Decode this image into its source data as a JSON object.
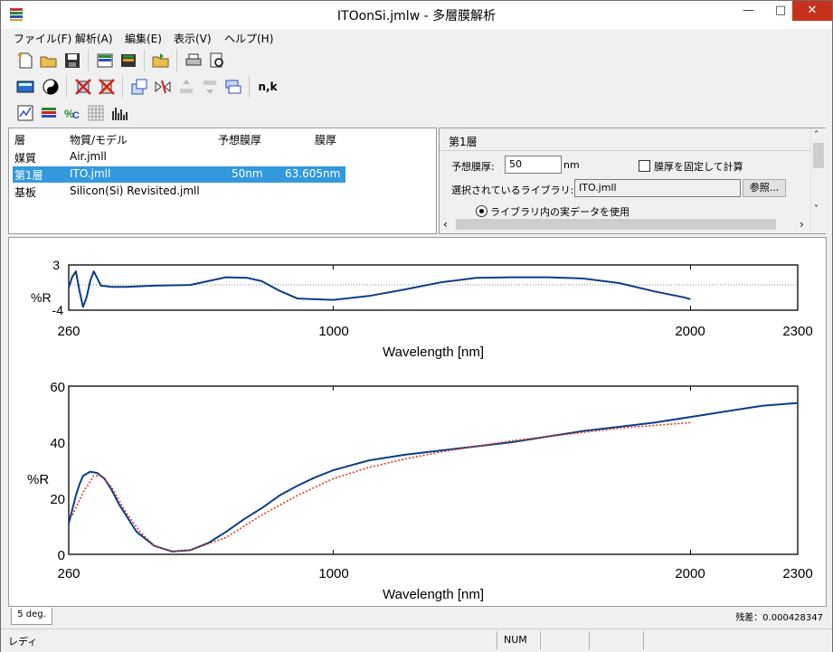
{
  "window": {
    "title": "ITOonSi.jmlw - 多層膜解析",
    "minimize": "—",
    "maximize": "□",
    "close": "✕"
  },
  "menu": [
    "ファイル(F)",
    "解析(A)",
    "編集(E)",
    "表示(V)",
    "ヘルプ(H)"
  ],
  "toolbar": {
    "nk_label": "n,k"
  },
  "layer_list": {
    "headers": {
      "layer": "層",
      "material": "物質/モデル",
      "expected": "予想膜厚",
      "thickness": "膜厚"
    },
    "rows": [
      {
        "layer": "媒質",
        "material": "Air.jmll",
        "expected": "",
        "thickness": ""
      },
      {
        "layer": "第1層",
        "material": "ITO.jmll",
        "expected": "50nm",
        "thickness": "63.605nm"
      },
      {
        "layer": "基板",
        "material": "Silicon(Si) Revisited.jmll",
        "expected": "",
        "thickness": ""
      }
    ]
  },
  "properties": {
    "title": "第1層",
    "expected_label": "予想膜厚:",
    "expected_value": "50",
    "unit": "nm",
    "fix_label": "膜厚を固定して計算",
    "library_label": "選択されているライブラリ:",
    "library_value": "ITO.jmll",
    "browse": "参照...",
    "radio_label": "ライブラリ内の実データを使用"
  },
  "chart_data": [
    {
      "type": "line",
      "ylabel": "%R",
      "xlabel": "Wavelength [nm]",
      "xlim": [
        260,
        2300
      ],
      "ylim": [
        -4,
        3
      ],
      "xticks": [
        "260",
        "1000",
        "2000",
        "2300"
      ],
      "yticks": [
        "3",
        "-4"
      ],
      "series": [
        {
          "color": "#0a3d8a",
          "x": [
            260,
            270,
            280,
            290,
            300,
            310,
            320,
            330,
            350,
            380,
            420,
            500,
            600,
            700,
            760,
            800,
            850,
            900,
            950,
            1000,
            1100,
            1200,
            1300,
            1400,
            1500,
            1600,
            1700,
            1800,
            1900,
            1980,
            2000
          ],
          "y": [
            -0.5,
            1.2,
            2.0,
            -1.0,
            -3.5,
            -2.0,
            0.5,
            2.0,
            -0.2,
            -0.4,
            -0.4,
            -0.2,
            -0.1,
            1.1,
            1.0,
            0.5,
            -1.0,
            -2.2,
            -2.3,
            -2.4,
            -1.8,
            -0.8,
            0.3,
            1.0,
            1.1,
            1.1,
            0.9,
            0.2,
            -1.1,
            -2.0,
            -2.3
          ]
        }
      ]
    },
    {
      "type": "line",
      "ylabel": "%R",
      "xlabel": "Wavelength [nm]",
      "xlim": [
        260,
        2300
      ],
      "ylim": [
        0,
        60
      ],
      "xticks": [
        "260",
        "1000",
        "2000",
        "2300"
      ],
      "yticks": [
        "60",
        "40",
        "20",
        "0"
      ],
      "series": [
        {
          "color": "#0a3d8a",
          "x": [
            260,
            270,
            280,
            290,
            300,
            320,
            340,
            360,
            380,
            400,
            450,
            500,
            550,
            600,
            650,
            700,
            750,
            800,
            850,
            900,
            950,
            1000,
            1100,
            1200,
            1300,
            1400,
            1500,
            1600,
            1700,
            1800,
            1900,
            2000,
            2100,
            2200,
            2300
          ],
          "y": [
            11,
            16,
            21,
            25,
            28,
            29.5,
            29,
            27,
            23,
            18,
            8,
            3,
            1,
            1.5,
            4,
            8,
            12.5,
            16.5,
            21,
            24.5,
            27.5,
            30,
            33.5,
            35.5,
            37,
            38.5,
            40,
            42,
            44,
            45.5,
            47,
            49,
            51,
            53,
            54
          ]
        },
        {
          "color": "#e03a1e",
          "x": [
            270,
            300,
            330,
            350,
            380,
            420,
            460,
            500,
            550,
            600,
            700,
            800,
            900,
            1000,
            1100,
            1200,
            1300,
            1400,
            1500,
            1600,
            1700,
            1800,
            1900,
            2000
          ],
          "y": [
            14,
            22,
            28,
            28,
            24,
            15,
            8,
            3,
            1,
            1.5,
            6,
            14,
            21,
            27,
            31,
            34,
            36.5,
            38.5,
            40.5,
            42,
            43.5,
            45,
            46,
            47
          ]
        }
      ]
    }
  ],
  "tab_label": "5 deg.",
  "residual": "残差：0.000428347",
  "status": {
    "ready": "レディ",
    "num": "NUM"
  }
}
